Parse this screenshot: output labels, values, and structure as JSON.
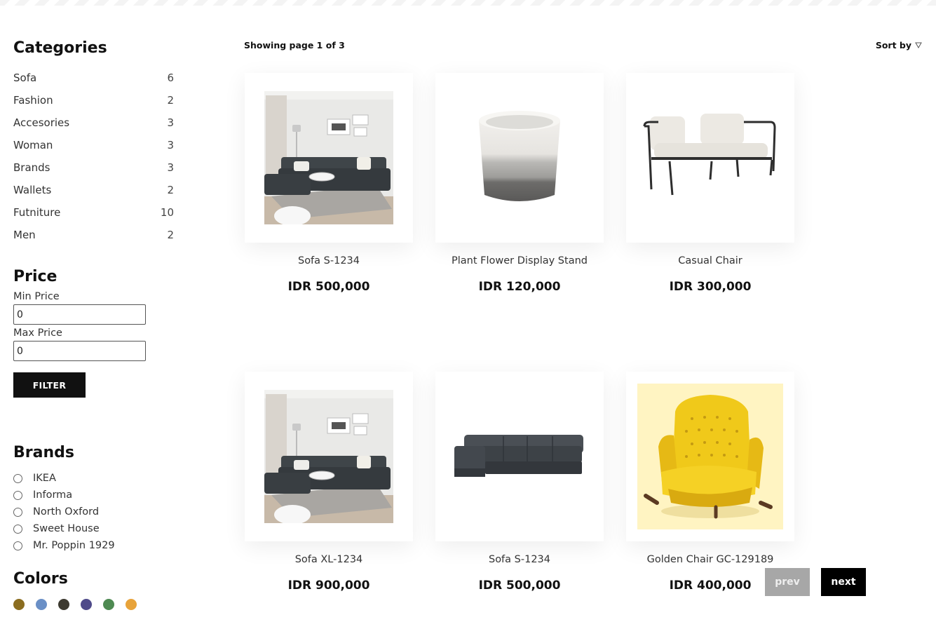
{
  "sidebar": {
    "categories_title": "Categories",
    "categories": [
      {
        "label": "Sofa",
        "count": "6"
      },
      {
        "label": "Fashion",
        "count": "2"
      },
      {
        "label": "Accesories",
        "count": "3"
      },
      {
        "label": "Woman",
        "count": "3"
      },
      {
        "label": "Brands",
        "count": "3"
      },
      {
        "label": "Wallets",
        "count": "2"
      },
      {
        "label": "Futniture",
        "count": "10"
      },
      {
        "label": "Men",
        "count": "2"
      }
    ],
    "price_title": "Price",
    "min_label": "Min Price",
    "min_value": "0",
    "max_label": "Max Price",
    "max_value": "0",
    "filter_label": "FILTER",
    "brands_title": "Brands",
    "brands": [
      "IKEA",
      "Informa",
      "North Oxford",
      "Sweet House",
      "Mr. Poppin 1929"
    ],
    "colors_title": "Colors",
    "colors": [
      "#8b6d20",
      "#6a8fc6",
      "#3d3a30",
      "#4f4a8a",
      "#4e8a52",
      "#e8a33a"
    ]
  },
  "main": {
    "showing": "Showing page 1 of 3",
    "sort_label": "Sort by",
    "products": [
      {
        "name": "Sofa S-1234",
        "price": "IDR 500,000",
        "image": "living-room-sofa"
      },
      {
        "name": "Plant Flower Display Stand",
        "price": "IDR 120,000",
        "image": "concrete-planter"
      },
      {
        "name": "Casual Chair",
        "price": "IDR 300,000",
        "image": "metal-loveseat"
      },
      {
        "name": "Sofa XL-1234",
        "price": "IDR 900,000",
        "image": "living-room-sofa"
      },
      {
        "name": "Sofa S-1234",
        "price": "IDR 500,000",
        "image": "sectional-sofa"
      },
      {
        "name": "Golden Chair GC-129189",
        "price": "IDR 400,000",
        "image": "yellow-wingback-chair"
      }
    ],
    "pager": {
      "prev": "prev",
      "next": "next"
    }
  }
}
